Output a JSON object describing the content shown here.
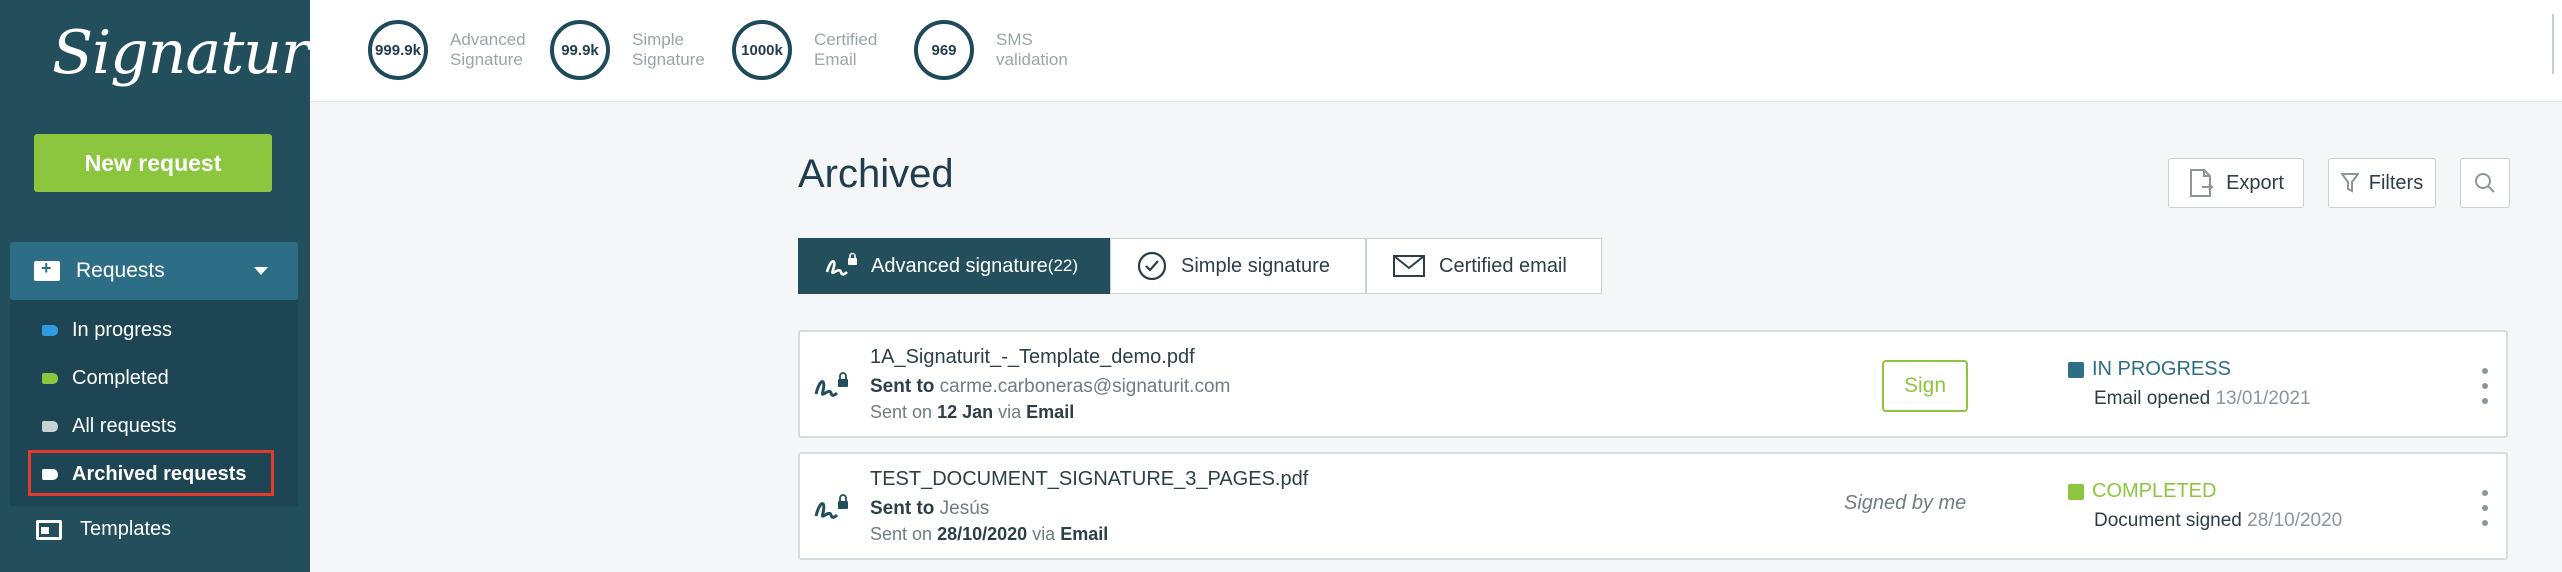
{
  "brand": {
    "logo_text": "Signaturit",
    "accent": "#8cc63f",
    "sidebar_bg": "#234e5c"
  },
  "sidebar": {
    "new_request": "New request",
    "requests_label": "Requests",
    "items": [
      {
        "label": "In progress",
        "color": "#2f9be0"
      },
      {
        "label": "Completed",
        "color": "#8cc63f"
      },
      {
        "label": "All requests",
        "color": "#c7d2d7"
      },
      {
        "label": "Archived requests",
        "color": "#ffffff"
      }
    ],
    "templates_label": "Templates"
  },
  "counters": [
    {
      "value": "999.9k",
      "label_line1": "Advanced",
      "label_line2": "Signature"
    },
    {
      "value": "99.9k",
      "label_line1": "Simple",
      "label_line2": "Signature"
    },
    {
      "value": "1000k",
      "label_line1": "Certified",
      "label_line2": "Email"
    },
    {
      "value": "969",
      "label_line1": "SMS",
      "label_line2": "validation"
    }
  ],
  "main": {
    "title": "Archived",
    "export_label": "Export",
    "filters_label": "Filters",
    "tabs": [
      {
        "label": "Advanced signature",
        "count": "(22)"
      },
      {
        "label": "Simple signature"
      },
      {
        "label": "Certified email"
      }
    ]
  },
  "documents": [
    {
      "name": "1A_Signaturit_-_Template_demo.pdf",
      "sent_to_label": "Sent to",
      "sent_to": "carme.carboneras@signaturit.com",
      "sent_on_label": "Sent on",
      "sent_date": "12 Jan",
      "via_label": "via",
      "channel": "Email",
      "action": "Sign",
      "status": "IN PROGRESS",
      "status_color": "#2d6e86",
      "status_detail": "Email opened",
      "status_date": "13/01/2021"
    },
    {
      "name": "TEST_DOCUMENT_SIGNATURE_3_PAGES.pdf",
      "sent_to_label": "Sent to",
      "sent_to": "Jesús",
      "sent_on_label": "Sent on",
      "sent_date": "28/10/2020",
      "via_label": "via",
      "channel": "Email",
      "note": "Signed by me",
      "status": "COMPLETED",
      "status_color": "#8cc63f",
      "status_detail": "Document signed",
      "status_date": "28/10/2020"
    }
  ]
}
